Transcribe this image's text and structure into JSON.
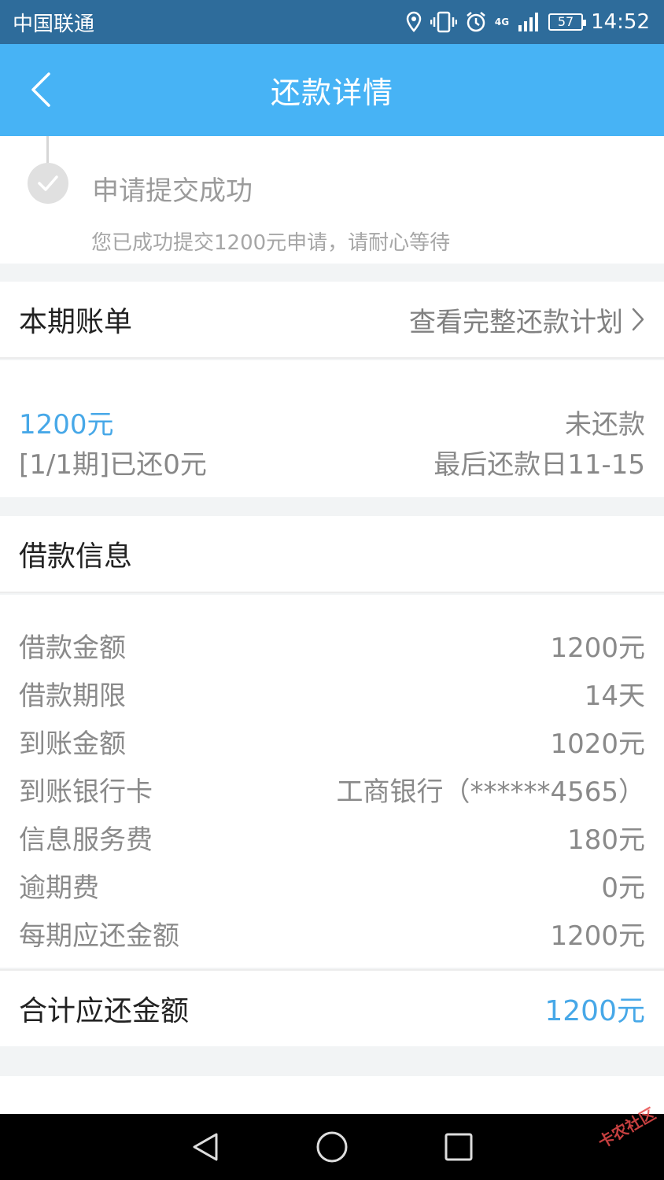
{
  "status_bar": {
    "carrier": "中国联通",
    "network": "4G",
    "battery": "57",
    "time": "14:52"
  },
  "navbar": {
    "title": "还款详情"
  },
  "progress": {
    "title": "申请提交成功",
    "description": "您已成功提交1200元申请，请耐心等待"
  },
  "bill": {
    "header": "本期账单",
    "link_label": "查看完整还款计划",
    "amount": "1200元",
    "status": "未还款",
    "period_paid": "[1/1期]已还0元",
    "due_date": "最后还款日11-15"
  },
  "loan_info": {
    "header": "借款信息",
    "rows": [
      {
        "label": "借款金额",
        "value": "1200元"
      },
      {
        "label": "借款期限",
        "value": "14天"
      },
      {
        "label": "到账金额",
        "value": "1020元"
      },
      {
        "label": "到账银行卡",
        "value": "工商银行（******4565）"
      },
      {
        "label": "信息服务费",
        "value": "180元"
      },
      {
        "label": "逾期费",
        "value": "0元"
      },
      {
        "label": "每期应还金额",
        "value": "1200元"
      }
    ],
    "total_label": "合计应还金额",
    "total_value": "1200元"
  },
  "colors": {
    "navbar": "#47b3f5",
    "accent_blue": "#47a8e8",
    "statusbar": "#2e6c9b"
  },
  "watermark": "卡农社区"
}
